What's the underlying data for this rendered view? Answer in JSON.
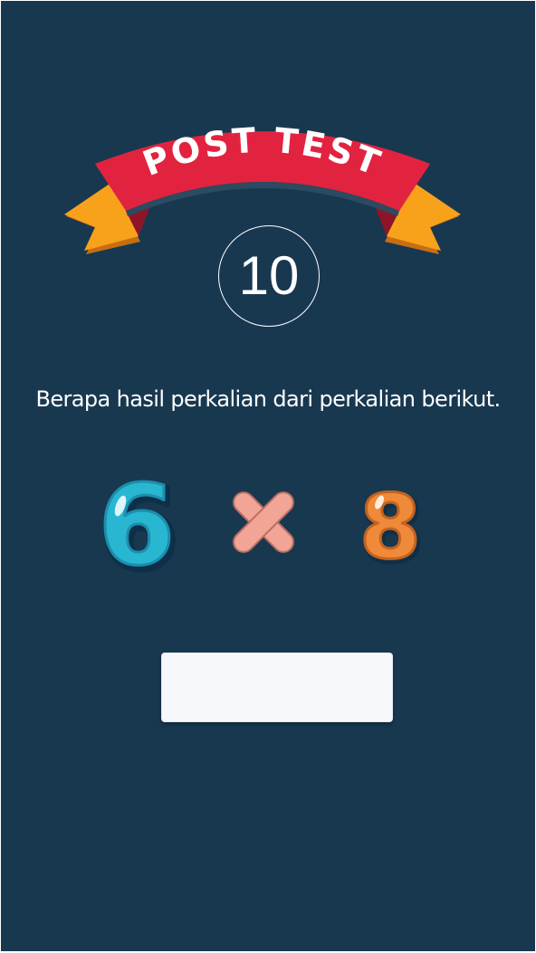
{
  "banner": {
    "title": "POST TEST"
  },
  "question": {
    "number": "10",
    "prompt": "Berapa hasil perkalian dari perkalian berikut.",
    "operand_left": "6",
    "operator": "×",
    "operand_right": "8"
  },
  "answer": {
    "value": "",
    "placeholder": ""
  },
  "colors": {
    "background": "#183850",
    "ribbon_red": "#e2233f",
    "ribbon_orange": "#f8a21b",
    "digit_six": "#29b6d1",
    "multiply_sign": "#f2a597",
    "digit_eight": "#ef8a3a"
  },
  "icons": {
    "banner": "ribbon-banner",
    "operand_left": "bubble-digit-six",
    "operator": "bubble-multiply-sign",
    "operand_right": "bubble-digit-eight"
  }
}
